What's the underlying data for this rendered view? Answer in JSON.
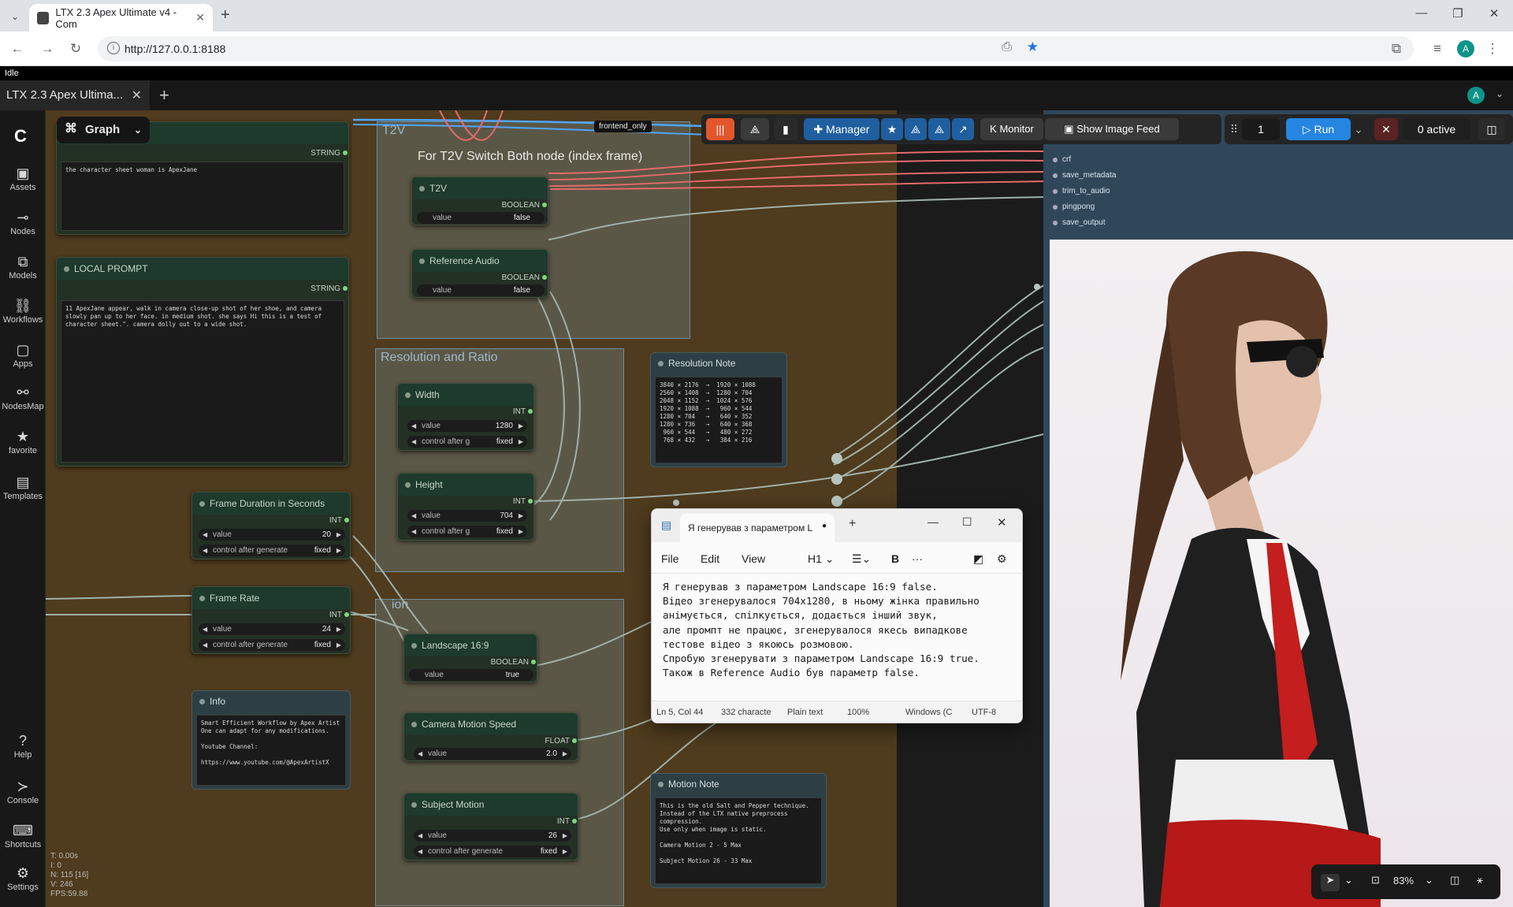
{
  "browser": {
    "tab_title": "LTX 2.3 Apex Ultimate v4 - Com",
    "url": "http://127.0.0.1:8188",
    "profile_initial": "A"
  },
  "app": {
    "status": "Idle",
    "workflow_tab": "LTX 2.3 Apex Ultima...",
    "user_initial": "A",
    "graph_label": "Graph"
  },
  "sidebar": {
    "items": [
      "Assets",
      "Nodes",
      "Models",
      "Workflows",
      "Apps",
      "NodesMap",
      "favorite",
      "Templates"
    ],
    "bottom": [
      "Help",
      "Console",
      "Shortcuts",
      "Settings"
    ]
  },
  "top_toolbar": {
    "manager": "Manager",
    "monitor": "Monitor",
    "show_image_feed": "Show Image Feed",
    "queue_count": "1",
    "run": "Run",
    "active": "0 active",
    "frontend_only": "frontend_only"
  },
  "groups": {
    "t2v": "T2V",
    "t2v_note": "For T2V Switch Both node (index frame)",
    "resolution": "Resolution and Ratio",
    "mid": "ion"
  },
  "nodes": {
    "top_prompt": {
      "title": "T",
      "type": "STRING",
      "text": "the character sheet woman is ApexJane"
    },
    "local_prompt": {
      "title": "LOCAL PROMPT",
      "type": "STRING",
      "text": "11 ApexJane appear, walk in camera close-up shot of her shoe, and camera slowly pan up to her face. in medium shot. she says Hi this is a test of character sheet.\". camera dolly out to a wide shot."
    },
    "t2v": {
      "title": "T2V",
      "type": "BOOLEAN",
      "label": "value",
      "value": "false"
    },
    "reference_audio": {
      "title": "Reference Audio",
      "type": "BOOLEAN",
      "label": "value",
      "value": "false"
    },
    "width": {
      "title": "Width",
      "type": "INT",
      "label": "value",
      "value": "1280",
      "ctrl_label": "control after g",
      "ctrl_value": "fixed"
    },
    "height": {
      "title": "Height",
      "type": "INT",
      "label": "value",
      "value": "704",
      "ctrl_label": "control after g",
      "ctrl_value": "fixed"
    },
    "frame_duration": {
      "title": "Frame Duration in Seconds",
      "type": "INT",
      "label": "value",
      "value": "20",
      "ctrl_label": "control after generate",
      "ctrl_value": "fixed"
    },
    "frame_rate": {
      "title": "Frame Rate",
      "type": "INT",
      "label": "value",
      "value": "24",
      "ctrl_label": "control after generate",
      "ctrl_value": "fixed"
    },
    "landscape": {
      "title": "Landscape 16:9",
      "type": "BOOLEAN",
      "label": "value",
      "value": "true"
    },
    "camera_motion": {
      "title": "Camera Motion Speed",
      "type": "FLOAT",
      "label": "value",
      "value": "2.0"
    },
    "subject_motion": {
      "title": "Subject Motion",
      "type": "INT",
      "label": "value",
      "value": "26",
      "ctrl_label": "control after generate",
      "ctrl_value": "fixed"
    },
    "info": {
      "title": "Info",
      "text": "Smart Efficient Workflow by Apex Artist\nOne can adapt for any modifications.\n\nYoutube Channel:\n\nhttps://www.youtube.com/@ApexArtistX"
    },
    "resolution_note": {
      "title": "Resolution Note",
      "text": "3840 × 2176  →  1920 × 1088\n2560 × 1408  →  1280 × 704\n2048 × 1152  →  1024 × 576\n1920 × 1088  →   960 × 544\n1280 × 704   →   640 × 352\n1280 × 736   →   640 × 368\n 960 × 544   →   480 × 272\n 768 × 432   →   384 × 216"
    },
    "motion_note": {
      "title": "Motion Note",
      "text": "This is the old Salt and Pepper technique.\nInstead of the LTX native preprocess compression.\nUse only when image is static.\n\nCamera Motion 2 - 5 Max\n\nSubject Motion 26 - 33 Max"
    }
  },
  "preview": {
    "rows": [
      "crf",
      "save_metadata",
      "trim_to_audio",
      "pingpong",
      "save_output"
    ]
  },
  "notepad": {
    "tab": "Я генерував з параметром L",
    "menu": [
      "File",
      "Edit",
      "View"
    ],
    "heading": "H1",
    "text": "Я генерував з параметром Landscape 16:9 false.\nВідео згенерувалося 704x1280, в ньому жінка правильно\nанімується, спілкується, додається інший звук,\nале промпт не працює, згенерувалося якесь випадкове\nтестове відео з якоюсь розмовою.\nСпробую згенерувати з параметром Landscape 16:9 true.\nТакож в Reference Audio був параметр false.",
    "status": {
      "position": "Ln 5, Col 44",
      "chars": "332 characte",
      "format": "Plain text",
      "zoom": "100%",
      "eol": "Windows (C",
      "encoding": "UTF-8"
    }
  },
  "canvas_stats": [
    "T: 0.00s",
    "I: 0",
    "N: 115 [16]",
    "V: 246",
    "FPS:59.88"
  ],
  "zoom_level": "83%"
}
